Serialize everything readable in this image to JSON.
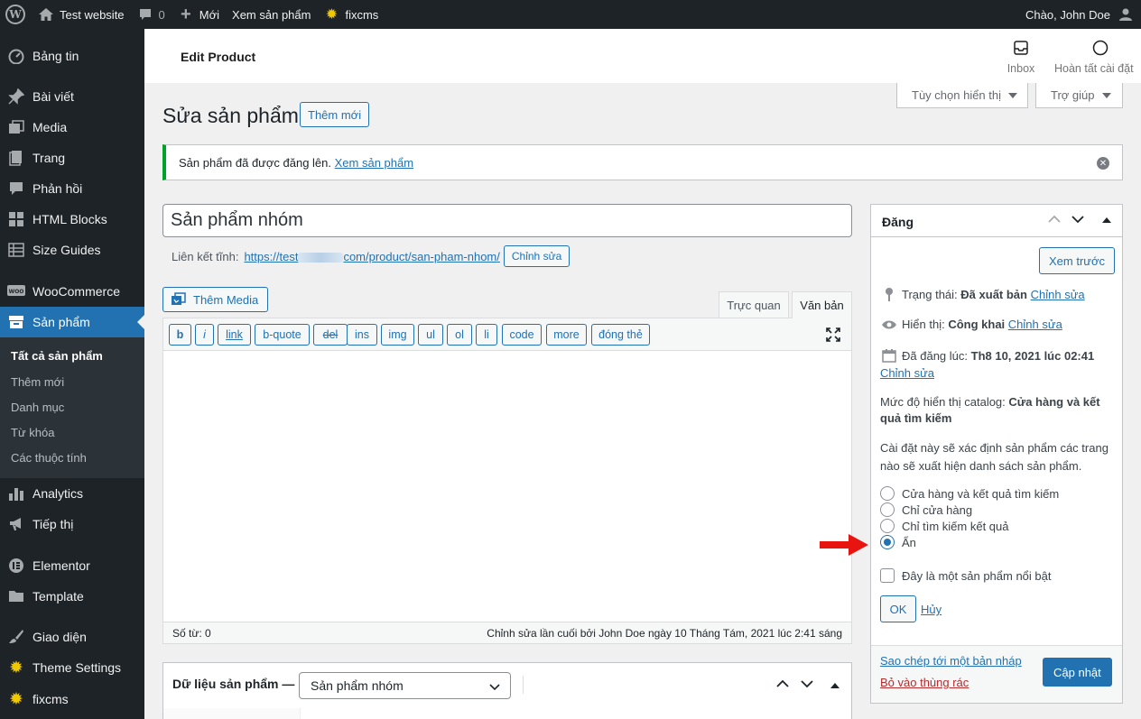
{
  "adminbar": {
    "site_name": "Test website",
    "comments_count": "0",
    "new_label": "Mới",
    "view_product": "Xem sản phẩm",
    "plugin": "fixcms",
    "greeting": "Chào, John Doe"
  },
  "sidebar": {
    "items": [
      {
        "label": "Bảng tin",
        "icon": "dashboard-icon"
      },
      {
        "label": "Bài viết",
        "icon": "pin-icon"
      },
      {
        "label": "Media",
        "icon": "media-icon"
      },
      {
        "label": "Trang",
        "icon": "page-icon"
      },
      {
        "label": "Phản hồi",
        "icon": "comment-icon"
      },
      {
        "label": "HTML Blocks",
        "icon": "grid-icon"
      },
      {
        "label": "Size Guides",
        "icon": "table-icon"
      },
      {
        "label": "WooCommerce",
        "icon": "woo-icon"
      },
      {
        "label": "Sản phẩm",
        "icon": "archive-icon"
      },
      {
        "label": "Analytics",
        "icon": "chart-icon"
      },
      {
        "label": "Tiếp thị",
        "icon": "megaphone-icon"
      },
      {
        "label": "Elementor",
        "icon": "elementor-icon"
      },
      {
        "label": "Template",
        "icon": "folder-icon"
      },
      {
        "label": "Giao diện",
        "icon": "brush-icon"
      },
      {
        "label": "Theme Settings",
        "icon": "gear-icon"
      },
      {
        "label": "fixcms",
        "icon": "gear-icon"
      }
    ],
    "submenu": [
      "Tất cả sản phẩm",
      "Thêm mới",
      "Danh mục",
      "Từ khóa",
      "Các thuộc tính"
    ]
  },
  "header": {
    "title": "Edit Product",
    "inbox": "Inbox",
    "setup": "Hoàn tất cài đặt"
  },
  "screen_options": "Tùy chọn hiển thị",
  "help": "Trợ giúp",
  "page": {
    "title": "Sửa sản phẩm",
    "add_new": "Thêm mới"
  },
  "notice": {
    "text": "Sản phẩm đã được đăng lên.",
    "link": "Xem sản phẩm"
  },
  "post": {
    "title": "Sản phẩm nhóm",
    "permalink_label": "Liên kết tĩnh:",
    "permalink_prefix": "https://test",
    "permalink_suffix": "com/product/",
    "permalink_slug": "san-pham-nhom",
    "edit_slug": "Chỉnh sửa"
  },
  "editor": {
    "add_media": "Thêm Media",
    "tab_visual": "Trực quan",
    "tab_text": "Văn bản",
    "quicktags": [
      "b",
      "i",
      "link",
      "b-quote",
      "del",
      "ins",
      "img",
      "ul",
      "ol",
      "li",
      "code",
      "more",
      "đóng thẻ"
    ],
    "word_count": "Số từ: 0",
    "last_edit": "Chỉnh sửa lần cuối bởi John Doe ngày 10 Tháng Tám, 2021 lúc 2:41 sáng"
  },
  "product_data": {
    "title": "Dữ liệu sản phẩm —",
    "type": "Sản phẩm nhóm"
  },
  "publish": {
    "title": "Đăng",
    "preview": "Xem trước",
    "status_label": "Trạng thái:",
    "status_value": "Đã xuất bản",
    "visibility_label": "Hiển thị:",
    "visibility_value": "Công khai",
    "published_label": "Đã đăng lúc:",
    "published_value": "Th8 10, 2021 lúc 02:41",
    "edit": "Chỉnh sửa",
    "catalog_label": "Mức độ hiển thị catalog:",
    "catalog_value_1": "Cửa hàng và kết",
    "catalog_value_2": "quả tìm kiếm",
    "description_1": "Cài đặt này sẽ xác định sản phẩm các trang",
    "description_2": "nào sẽ xuất hiện danh sách sản phẩm.",
    "options": [
      "Cửa hàng và kết quả tìm kiếm",
      "Chỉ cửa hàng",
      "Chỉ tìm kiếm kết quả",
      "Ẩn"
    ],
    "selected_option": "Ẩn",
    "featured": "Đây là một sản phẩm nổi bật",
    "ok": "OK",
    "cancel": "Hủy",
    "copy_draft": "Sao chép tới một bản nháp",
    "trash": "Bỏ vào thùng rác",
    "update": "Cập nhật"
  },
  "colors": {
    "accent": "#2271b1",
    "sidebar": "#1d2327",
    "success": "#00a32a",
    "danger": "#b32d2e",
    "annotation_arrow": "#e8140f"
  }
}
